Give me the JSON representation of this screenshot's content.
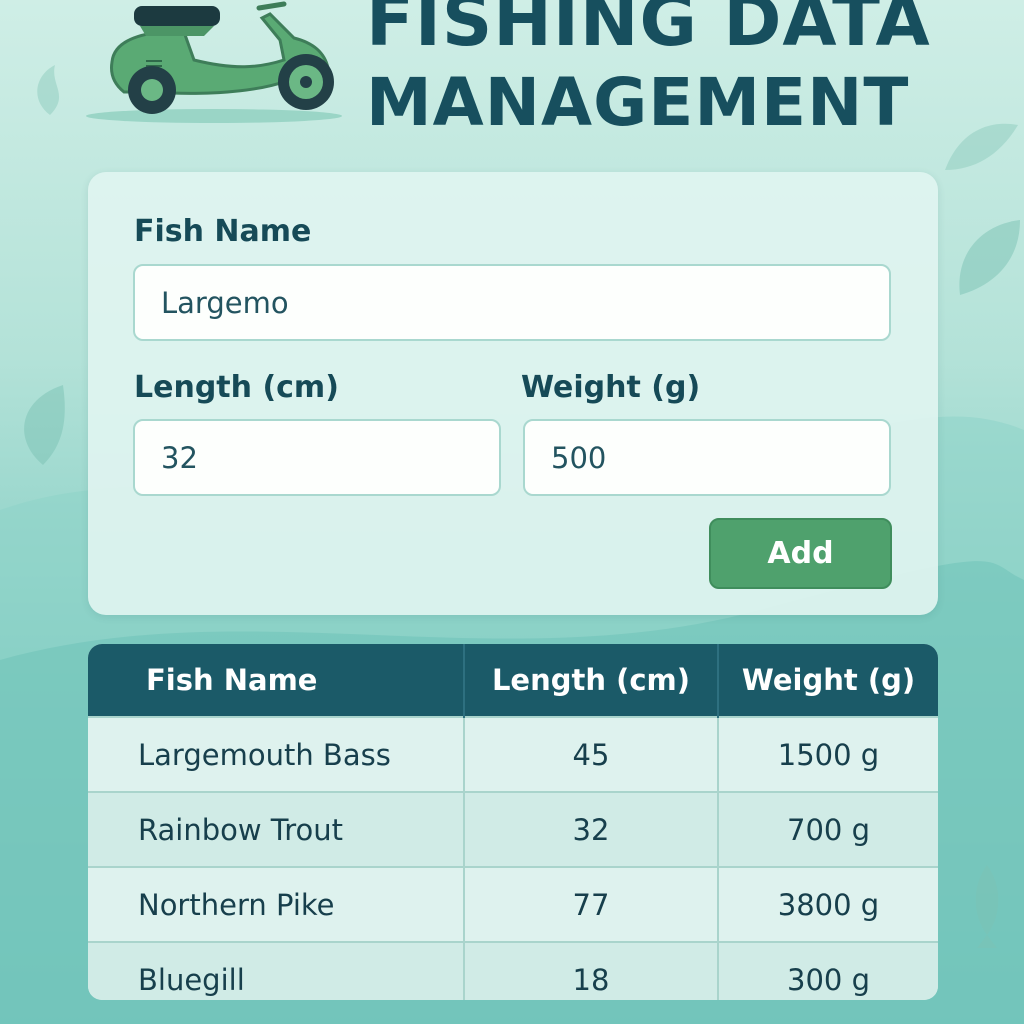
{
  "app": {
    "title_line1": "FISHING DATA",
    "title_line2": "MANAGEMENT",
    "logo": "scooter-icon"
  },
  "form": {
    "fish_name_label": "Fish Name",
    "fish_name_value": "Largemo",
    "length_label": "Length (cm)",
    "length_value": "32",
    "weight_label": "Weight (g)",
    "weight_value": "500",
    "add_label": "Add"
  },
  "table": {
    "headers": [
      "Fish Name",
      "Length (cm)",
      "Weight (g)"
    ],
    "rows": [
      [
        "Largemouth Bass",
        "45",
        "1500 g"
      ],
      [
        "Rainbow Trout",
        "32",
        "700 g"
      ],
      [
        "Northern Pike",
        "77",
        "3800 g"
      ],
      [
        "Bluegill",
        "18",
        "300 g"
      ]
    ]
  },
  "colors": {
    "background": "#b3e2d8",
    "title": "#174f5e",
    "table_header": "#1b5a68",
    "add_button": "#4fa16d",
    "scooter": "#5aaa74"
  }
}
